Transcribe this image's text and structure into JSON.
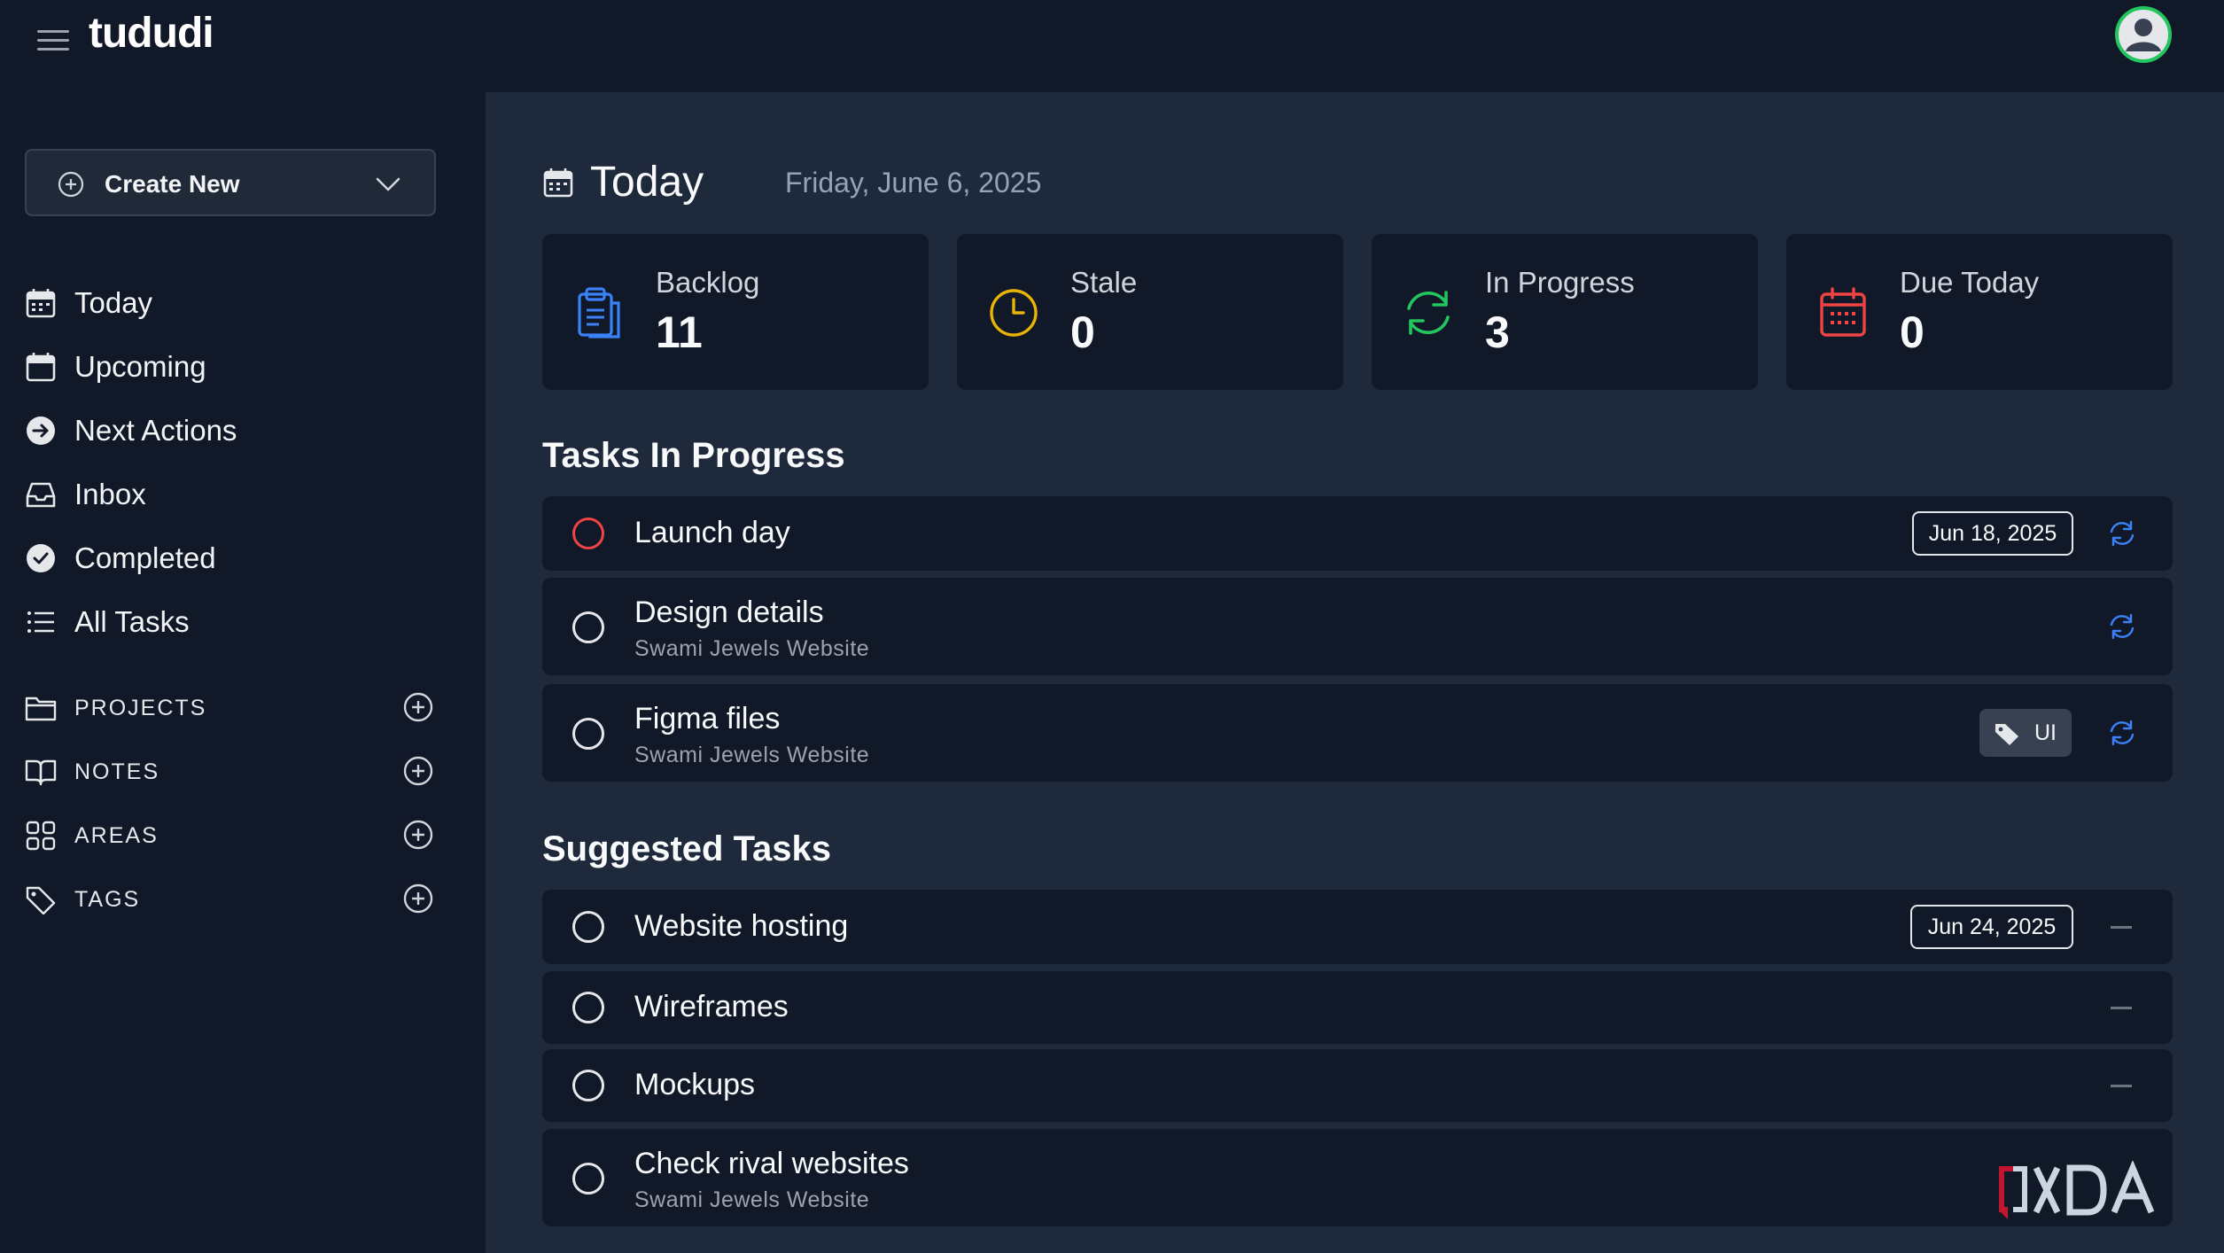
{
  "app": {
    "brand": "tududi",
    "colors": {
      "bg": "#1e293b",
      "panel": "#111827",
      "accent": "#3b82f6",
      "avatar_ring": "#22c55e"
    }
  },
  "sidebar": {
    "create_new": "Create New",
    "nav": [
      {
        "label": "Today",
        "icon": "calendar-icon"
      },
      {
        "label": "Upcoming",
        "icon": "calendar-blank-icon"
      },
      {
        "label": "Next Actions",
        "icon": "arrow-circle-icon"
      },
      {
        "label": "Inbox",
        "icon": "inbox-icon"
      },
      {
        "label": "Completed",
        "icon": "check-circle-icon"
      },
      {
        "label": "All Tasks",
        "icon": "list-icon"
      }
    ],
    "sections": [
      {
        "label": "PROJECTS",
        "icon": "folder-icon"
      },
      {
        "label": "NOTES",
        "icon": "book-icon"
      },
      {
        "label": "AREAS",
        "icon": "grid-icon"
      },
      {
        "label": "TAGS",
        "icon": "tag-icon"
      }
    ]
  },
  "main": {
    "title": "Today",
    "date": "Friday, June 6, 2025",
    "cards": [
      {
        "label": "Backlog",
        "value": "11",
        "icon": "clipboard-icon",
        "color": "#3b82f6"
      },
      {
        "label": "Stale",
        "value": "0",
        "icon": "clock-icon",
        "color": "#eab308"
      },
      {
        "label": "In Progress",
        "value": "3",
        "icon": "refresh-icon",
        "color": "#22c55e"
      },
      {
        "label": "Due Today",
        "value": "0",
        "icon": "calendar-due-icon",
        "color": "#ef4444"
      }
    ],
    "in_progress_title": "Tasks In Progress",
    "in_progress": [
      {
        "name": "Launch day",
        "project": "",
        "due": "Jun 18, 2025",
        "tag": ""
      },
      {
        "name": "Design details",
        "project": "Swami Jewels Website",
        "due": "",
        "tag": ""
      },
      {
        "name": "Figma files",
        "project": "Swami Jewels Website",
        "due": "",
        "tag": "UI"
      }
    ],
    "suggested_title": "Suggested Tasks",
    "suggested": [
      {
        "name": "Website hosting",
        "project": "",
        "due": "Jun 24, 2025"
      },
      {
        "name": "Wireframes",
        "project": "",
        "due": ""
      },
      {
        "name": "Mockups",
        "project": "",
        "due": ""
      },
      {
        "name": "Check rival websites",
        "project": "Swami Jewels Website",
        "due": ""
      }
    ]
  },
  "watermark": "XDA"
}
